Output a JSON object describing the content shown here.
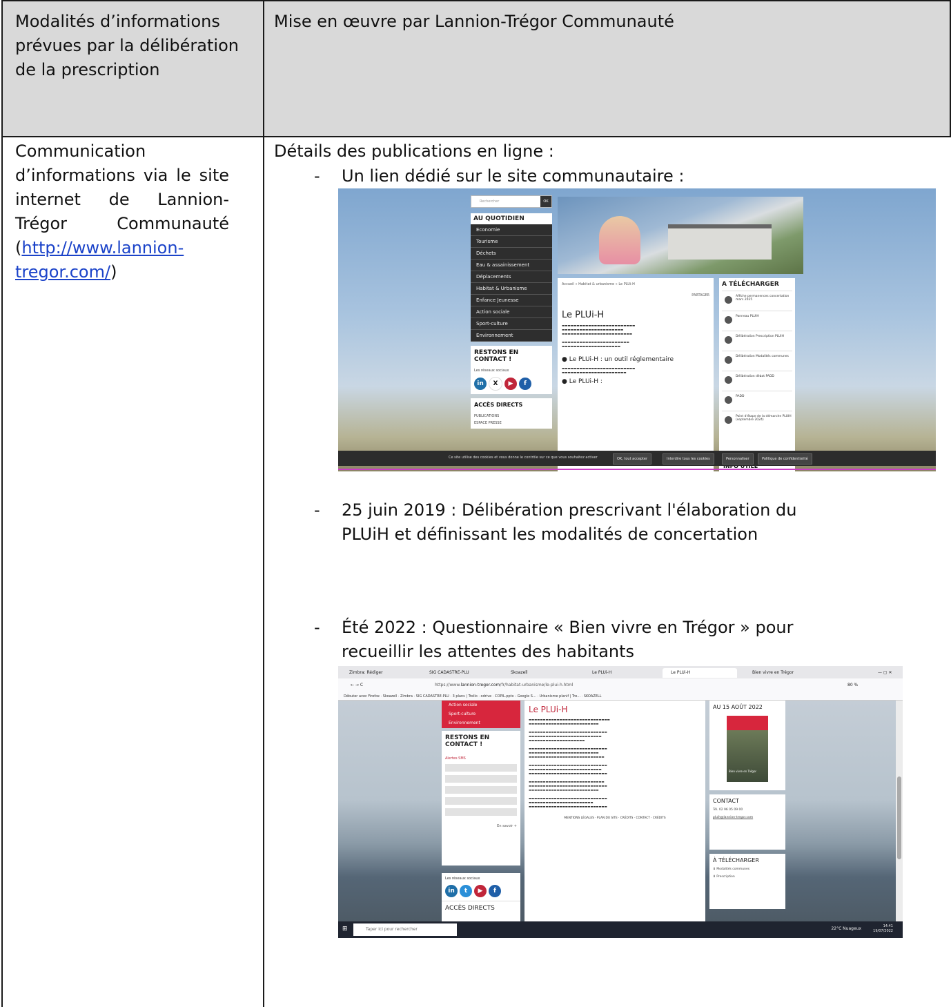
{
  "header": {
    "left": "Modalités d’informations prévues par la délibération de la prescription",
    "right": "Mise en œuvre par Lannion-Trégor Communauté"
  },
  "row": {
    "left_text": "Communication d’informations via le site internet de Lannion-Trégor Communauté (",
    "left_link": "http://www.lannion-tregor.com/",
    "left_close": ")",
    "title": "Détails des publications en ligne :",
    "bullets": [
      "Un lien dédié sur le site communautaire :",
      "25 juin 2019 : Délibération prescrivant l'élaboration du",
      "PLUiH et définissant les modalités de concertation",
      "Été 2022 : Questionnaire « Bien vivre en Trégor » pour",
      "recueillir les attentes des habitants"
    ]
  },
  "screenshot1": {
    "search": "Rechercher",
    "ok": "OK",
    "menu_title": "AU QUOTIDIEN",
    "menu": [
      "Economie",
      "Tourisme",
      "Déchets",
      "Eau & assainissement",
      "Déplacements",
      "Habitat & Urbanisme",
      "Enfance Jeunesse",
      "Action sociale",
      "Sport-culture",
      "Environnement"
    ],
    "contact_title": "RESTONS EN CONTACT !",
    "social_label": "Les réseaux sociaux",
    "access_title": "ACCÈS DIRECTS",
    "access_items": [
      "PUBLICATIONS",
      "ESPACE PRESSE"
    ],
    "breadcrumb": "Accueil » Habitat & urbanisme » Le PLUi-H",
    "share": "PARTAGER",
    "page_title": "Le PLUi-H",
    "subtitle": "Le PLUi-H : un outil réglementaire",
    "subtitle2": "Le PLUi-H :",
    "dl_title": "A TÉLÉCHARGER",
    "downloads": [
      "Affiche permanences concertation mars 2025",
      "Panneau PLUIH",
      "Délibération Prescription PLUIH",
      "Délibération Modalités communes",
      "Délibération débat PADD",
      "PADD",
      "Point d'étape de la démarche PLUIH (septembre 2024)"
    ],
    "info_title": "INFO UTILE",
    "cookie_text": "Ce site utilise des cookies et vous donne le contrôle sur ce que vous souhaitez activer",
    "cookie_buttons": [
      "OK, tout accepter",
      "Interdire tous les cookies",
      "Personnaliser",
      "Politique de confidentialité"
    ]
  },
  "screenshot2": {
    "tabs": [
      "Zimbra: Rédiger",
      "SIG CADASTRE-PLU",
      "Skoazell",
      "Le PLUi-H",
      "Le PLUi-H",
      "Bien vivre en Trégor"
    ],
    "url_prefix": "https://www.",
    "url_domain": "lannion-tregor.com",
    "url_path": "/fr/habitat-urbanisme/le-plui-h.html",
    "zoom": "80 %",
    "bookmarks": "Débuter avec Firefox · Skoazell · Zimbra · SIG CADASTRE-PLU · 3 plans | Trello · odrive · COPIL.pptx - Google S... · Urbanisme planif | Tre... · SKOAZELL",
    "red_menu": [
      "Action sociale",
      "Sport-culture",
      "Environnement"
    ],
    "contact_title": "RESTONS EN CONTACT !",
    "alerts": "Alertes SMS",
    "more": "En savoir +",
    "social_label": "Les réseaux sociaux",
    "access_title": "ACCÈS DIRECTS",
    "page_title": "Le PLUi-H",
    "date_box": "AU 15 AOÛT 2022",
    "poster_caption": "Bien vivre en Trégor",
    "contact_box": "CONTACT",
    "contact_email": "pluih@lannion-tregor.com",
    "contact_phone": "Tél. 02 96 05 09 00",
    "dl_title": "À TÉLÉCHARGER",
    "downloads": [
      "Modalités communes",
      "Prescription"
    ],
    "footer": "MENTIONS LÉGALES · PLAN DU SITE · CRÉDITS · CONTACT · CRÉDITS",
    "search_placeholder": "Taper ici pour rechercher",
    "weather": "22°C Nuageux",
    "time": "14:41",
    "date": "19/07/2022"
  }
}
